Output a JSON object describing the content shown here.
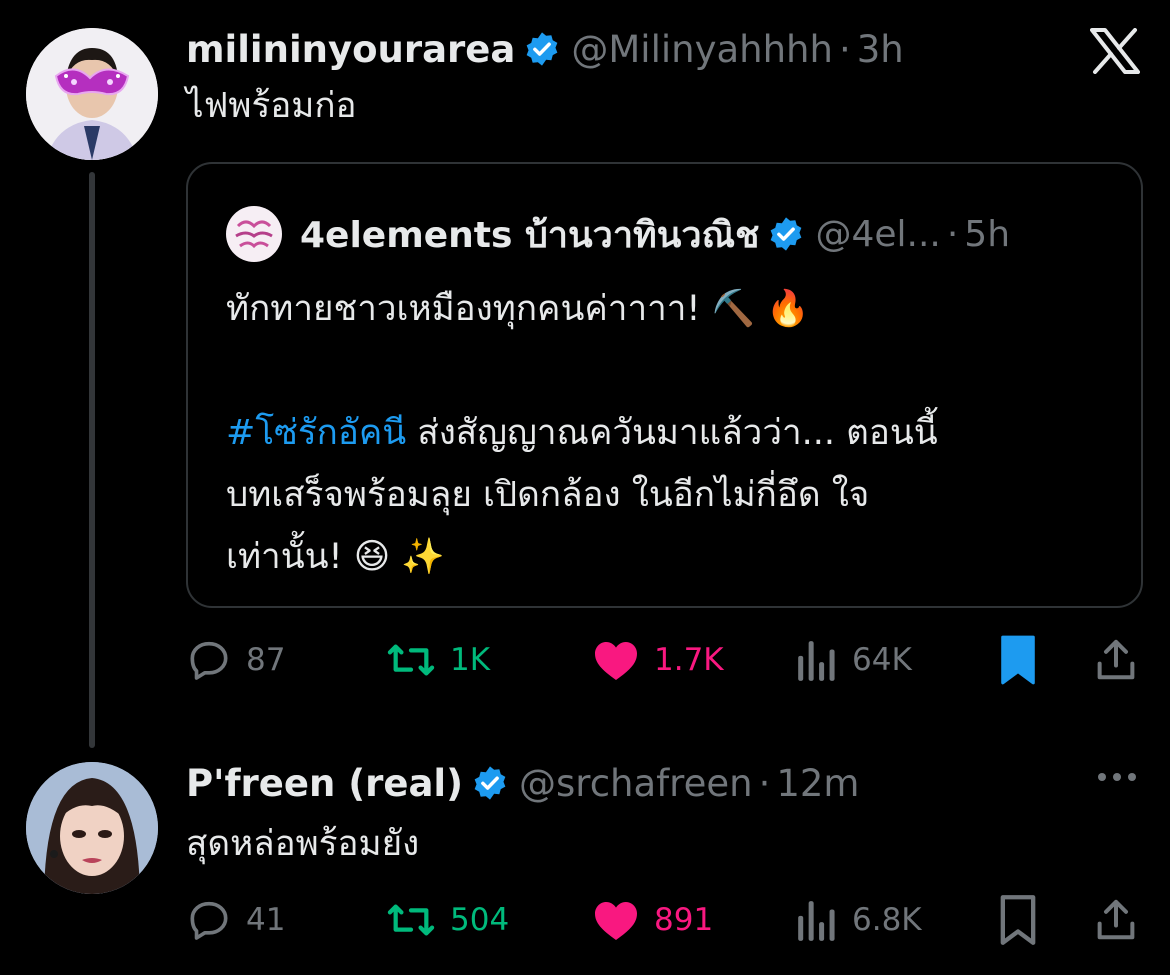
{
  "posts": [
    {
      "name": "milininyourarea",
      "handle": "@Milinyahhhh",
      "dot": "·",
      "time": "3h",
      "text": "ไฟพร้อมก่อ",
      "quote": {
        "name": "4elements บ้านวาทินวณิช",
        "handle": "@4el...",
        "dot": "·",
        "time": "5h",
        "line1": "ทักทายชาวเหมืองทุกคนค่าาาา! ⛏️ 🔥",
        "hashtag": "#โซ่รักอัคนี",
        "line2_rest": " ส่งสัญญาณควันมาแล้วว่า... ตอนนี้",
        "line3": "บทเสร็จพร้อมลุย เปิดกล้อง ในอีกไม่กี่อึด ใจ",
        "line4": "เท่านั้น! 😆 ✨"
      },
      "stats": {
        "replies": "87",
        "reposts": "1K",
        "likes": "1.7K",
        "views": "64K"
      },
      "bookmarked": true
    },
    {
      "name": "P'freen (real)",
      "handle": "@srchafreen",
      "dot": "·",
      "time": "12m",
      "text": "สุดหล่อพร้อมยัง",
      "stats": {
        "replies": "41",
        "reposts": "504",
        "likes": "891",
        "views": "6.8K"
      },
      "bookmarked": false
    }
  ],
  "colors": {
    "background": "#000000",
    "text": "#e7e9ea",
    "muted": "#71767b",
    "accent": "#1d9bf0",
    "repost": "#00ba7c",
    "like": "#f91880",
    "bookmark": "#1d9bf0"
  },
  "icons": [
    "x-logo-icon",
    "verified-badge-icon",
    "reply-icon",
    "repost-icon",
    "like-icon",
    "views-icon",
    "bookmark-icon",
    "share-icon",
    "more-icon"
  ]
}
